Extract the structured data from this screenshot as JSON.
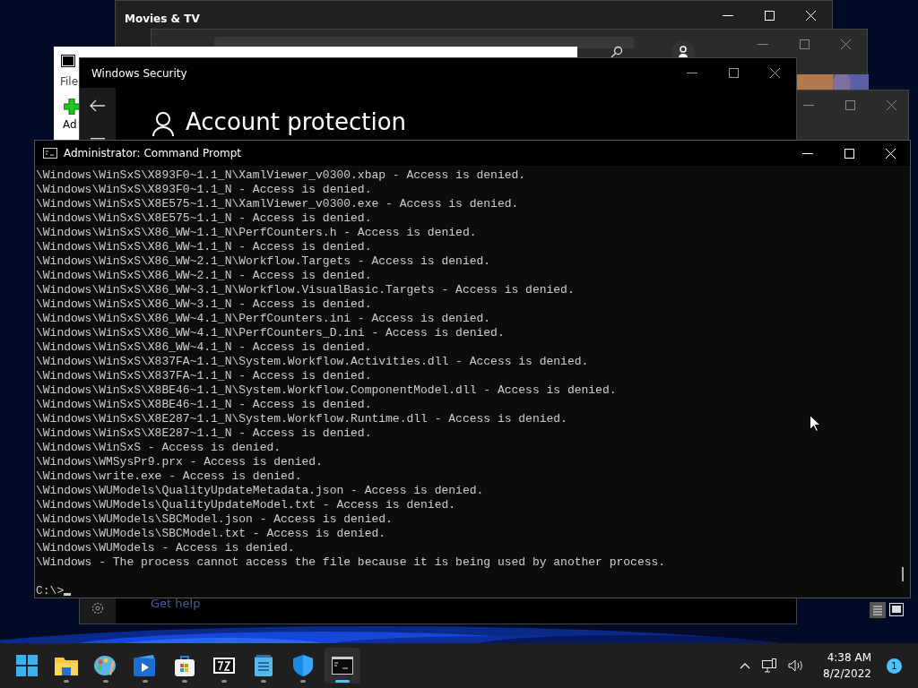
{
  "movies_window": {
    "title": "Movies & TV"
  },
  "zip_window": {
    "menu": "File",
    "toolbar_label": "Ad"
  },
  "security_window": {
    "title": "Windows Security",
    "heading": "Account protection",
    "help_link": "Get help"
  },
  "console_window": {
    "title": "Administrator: Command Prompt",
    "lines": [
      "\\Windows\\WinSxS\\X893F0~1.1_N\\XamlViewer_v0300.xbap - Access is denied.",
      "\\Windows\\WinSxS\\X893F0~1.1_N - Access is denied.",
      "\\Windows\\WinSxS\\X8E575~1.1_N\\XamlViewer_v0300.exe - Access is denied.",
      "\\Windows\\WinSxS\\X8E575~1.1_N - Access is denied.",
      "\\Windows\\WinSxS\\X86_WW~1.1_N\\PerfCounters.h - Access is denied.",
      "\\Windows\\WinSxS\\X86_WW~1.1_N - Access is denied.",
      "\\Windows\\WinSxS\\X86_WW~2.1_N\\Workflow.Targets - Access is denied.",
      "\\Windows\\WinSxS\\X86_WW~2.1_N - Access is denied.",
      "\\Windows\\WinSxS\\X86_WW~3.1_N\\Workflow.VisualBasic.Targets - Access is denied.",
      "\\Windows\\WinSxS\\X86_WW~3.1_N - Access is denied.",
      "\\Windows\\WinSxS\\X86_WW~4.1_N\\PerfCounters.ini - Access is denied.",
      "\\Windows\\WinSxS\\X86_WW~4.1_N\\PerfCounters_D.ini - Access is denied.",
      "\\Windows\\WinSxS\\X86_WW~4.1_N - Access is denied.",
      "\\Windows\\WinSxS\\X837FA~1.1_N\\System.Workflow.Activities.dll - Access is denied.",
      "\\Windows\\WinSxS\\X837FA~1.1_N - Access is denied.",
      "\\Windows\\WinSxS\\X8BE46~1.1_N\\System.Workflow.ComponentModel.dll - Access is denied.",
      "\\Windows\\WinSxS\\X8BE46~1.1_N - Access is denied.",
      "\\Windows\\WinSxS\\X8E287~1.1_N\\System.Workflow.Runtime.dll - Access is denied.",
      "\\Windows\\WinSxS\\X8E287~1.1_N - Access is denied.",
      "\\Windows\\WinSxS - Access is denied.",
      "\\Windows\\WMSysPr9.prx - Access is denied.",
      "\\Windows\\write.exe - Access is denied.",
      "\\Windows\\WUModels\\QualityUpdateMetadata.json - Access is denied.",
      "\\Windows\\WUModels\\QualityUpdateModel.txt - Access is denied.",
      "\\Windows\\WUModels\\SBCModel.json - Access is denied.",
      "\\Windows\\WUModels\\SBCModel.txt - Access is denied.",
      "\\Windows\\WUModels - Access is denied.",
      "\\Windows - The process cannot access the file because it is being used by another process."
    ],
    "prompt": "C:\\>"
  },
  "taskbar": {
    "apps": [
      {
        "kind": "start",
        "running": false,
        "selected": false
      },
      {
        "kind": "folder",
        "running": true,
        "selected": false
      },
      {
        "kind": "paint",
        "running": true,
        "selected": false
      },
      {
        "kind": "video",
        "running": true,
        "selected": false
      },
      {
        "kind": "store",
        "running": true,
        "selected": false
      },
      {
        "kind": "zip",
        "running": true,
        "selected": false
      },
      {
        "kind": "notepad",
        "running": true,
        "selected": false
      },
      {
        "kind": "shield",
        "running": true,
        "selected": false
      },
      {
        "kind": "console",
        "running": true,
        "selected": true
      }
    ],
    "time": "4:38 AM",
    "date": "8/2/2022",
    "notification_count": "1"
  }
}
